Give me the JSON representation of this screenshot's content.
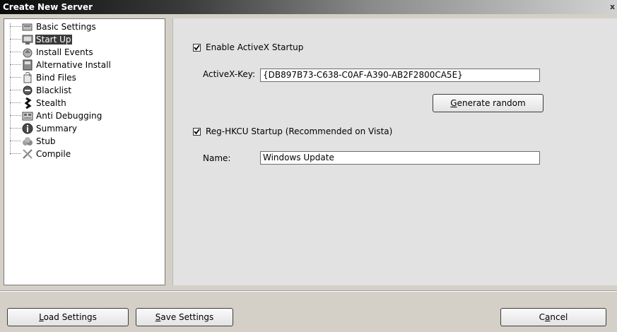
{
  "window": {
    "title": "Create New Server",
    "close_glyph": "x"
  },
  "tree": {
    "items": [
      {
        "label": "Basic Settings",
        "icon": "settings-icon"
      },
      {
        "label": "Start Up",
        "icon": "startup-icon",
        "selected": true
      },
      {
        "label": "Install Events",
        "icon": "install-events-icon"
      },
      {
        "label": "Alternative Install",
        "icon": "alternative-install-icon"
      },
      {
        "label": "Bind Files",
        "icon": "bind-files-icon"
      },
      {
        "label": "Blacklist",
        "icon": "blacklist-icon"
      },
      {
        "label": "Stealth",
        "icon": "stealth-icon"
      },
      {
        "label": "Anti Debugging",
        "icon": "anti-debugging-icon"
      },
      {
        "label": "Summary",
        "icon": "summary-icon"
      },
      {
        "label": "Stub",
        "icon": "stub-icon"
      },
      {
        "label": "Compile",
        "icon": "compile-icon"
      }
    ]
  },
  "startup": {
    "activex_label": "Enable ActiveX Startup",
    "activex_checked": true,
    "activex_key_label": "ActiveX-Key:",
    "activex_key_value": "{DB897B73-C638-C0AF-A390-AB2F2800CA5E}",
    "generate_prefix": "",
    "generate_accel": "G",
    "generate_rest": "enerate random",
    "reg_label": "Reg-HKCU Startup (Recommended on Vista)",
    "reg_checked": true,
    "name_label": "Name:",
    "name_value": "Windows Update"
  },
  "footer": {
    "load_accel": "L",
    "load_rest": "oad Settings",
    "save_accel": "S",
    "save_rest": "ave Settings",
    "cancel_prefix": "C",
    "cancel_accel": "a",
    "cancel_rest": "ncel"
  }
}
